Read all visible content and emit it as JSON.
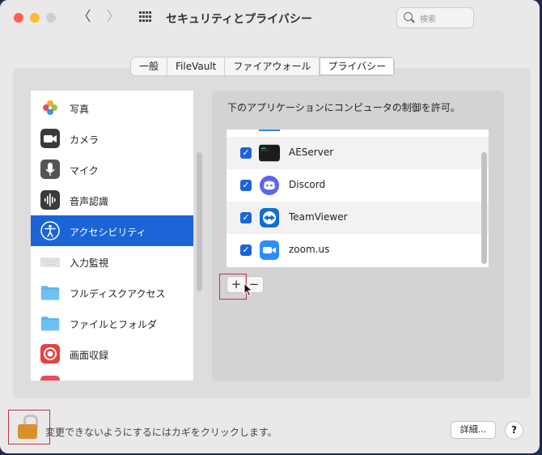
{
  "window": {
    "title": "セキュリティとプライバシー"
  },
  "toolbar": {
    "back_glyph": "〈",
    "forward_glyph": "〉",
    "search_placeholder": "検索"
  },
  "tabs": [
    {
      "label": "一般"
    },
    {
      "label": "FileVault"
    },
    {
      "label": "ファイアウォール"
    },
    {
      "label": "プライバシー",
      "active": true
    }
  ],
  "sidebar": {
    "items": [
      {
        "label": "写真",
        "icon": "photos-icon",
        "color": "#f5a623"
      },
      {
        "label": "カメラ",
        "icon": "camera-icon",
        "color": "#3a3a3c"
      },
      {
        "label": "マイク",
        "icon": "microphone-icon",
        "color": "#555557"
      },
      {
        "label": "音声認識",
        "icon": "speech-recognition-icon",
        "color": "#3a3a3c"
      },
      {
        "label": "アクセシビリティ",
        "icon": "accessibility-icon",
        "color": "#1b64d8",
        "active": true
      },
      {
        "label": "入力監視",
        "icon": "keyboard-icon",
        "color": "#e8e6e7"
      },
      {
        "label": "フルディスクアクセス",
        "icon": "folder-icon",
        "color": "#5fb4ee"
      },
      {
        "label": "ファイルとフォルダ",
        "icon": "folder-icon",
        "color": "#5fb4ee"
      },
      {
        "label": "画面収録",
        "icon": "screen-recording-icon",
        "color": "#e8413b"
      }
    ]
  },
  "main": {
    "description": "下のアプリケーションにコンピュータの制御を許可。",
    "apps": [
      {
        "name": "AEServer",
        "checked": true,
        "icon": "terminal-icon",
        "color": "#1c1c1e"
      },
      {
        "name": "Discord",
        "checked": true,
        "icon": "discord-icon",
        "color": "#5865f2"
      },
      {
        "name": "TeamViewer",
        "checked": true,
        "icon": "teamviewer-icon",
        "color": "#0e6ed4"
      },
      {
        "name": "zoom.us",
        "checked": true,
        "icon": "zoom-icon",
        "color": "#2d8cff"
      }
    ],
    "add_glyph": "+",
    "remove_glyph": "−"
  },
  "footer": {
    "lock_text": "変更できないようにするにはカギをクリックします。",
    "detail_label": "詳細...",
    "help_label": "?"
  }
}
